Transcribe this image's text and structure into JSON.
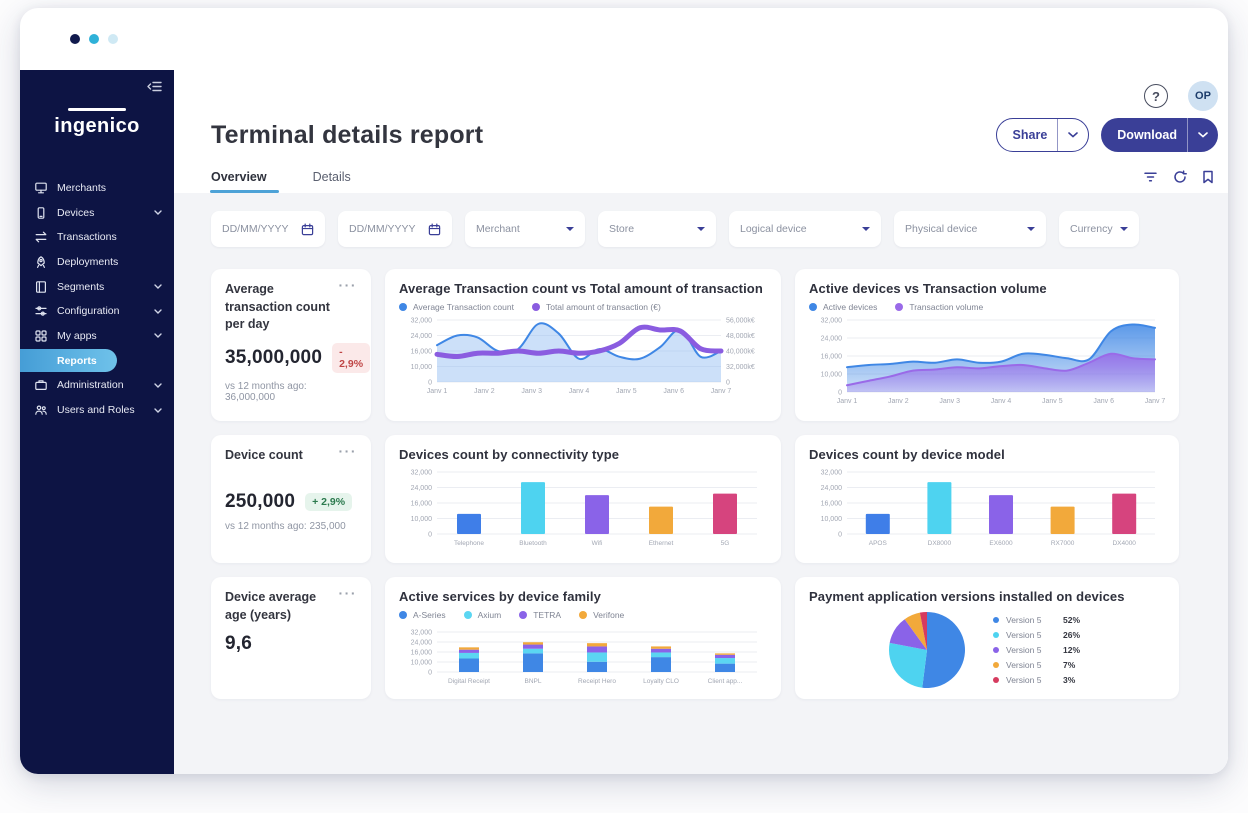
{
  "window": {
    "dots": [
      "#111a4d",
      "#2fb1d8",
      "#cfe9f4"
    ]
  },
  "ui": {
    "menu_icon": "···"
  },
  "sidebar": {
    "logo": "ingenico",
    "items": [
      {
        "label": "Merchants",
        "icon": "merchants"
      },
      {
        "label": "Devices",
        "icon": "devices",
        "chevron": true
      },
      {
        "label": "Transactions",
        "icon": "transactions"
      },
      {
        "label": "Deployments",
        "icon": "deployments"
      },
      {
        "label": "Segments",
        "icon": "segments",
        "chevron": true
      },
      {
        "label": "Configuration",
        "icon": "configuration",
        "chevron": true
      },
      {
        "label": "My apps",
        "icon": "myapps",
        "chevron": true
      },
      {
        "label": "Reports",
        "icon": "none",
        "active": true
      },
      {
        "label": "Administration",
        "icon": "administration",
        "chevron": true
      },
      {
        "label": "Users and Roles",
        "icon": "users",
        "chevron": true
      }
    ]
  },
  "header": {
    "title": "Terminal details report",
    "help_glyph": "?",
    "avatar_initials": "OP",
    "share_label": "Share",
    "download_label": "Download"
  },
  "tabs": [
    {
      "label": "Overview",
      "active": true
    },
    {
      "label": "Details",
      "active": false
    }
  ],
  "toolbar": {
    "icons": [
      "filter-icon",
      "refresh-icon",
      "bookmark-icon"
    ]
  },
  "filters": [
    {
      "name": "date-start",
      "type": "date",
      "placeholder": "DD/MM/YYYY"
    },
    {
      "name": "date-end",
      "type": "date",
      "placeholder": "DD/MM/YYYY"
    },
    {
      "name": "merchant",
      "type": "select",
      "label": "Merchant"
    },
    {
      "name": "store",
      "type": "select",
      "label": "Store"
    },
    {
      "name": "logical-device",
      "type": "select",
      "label": "Logical device"
    },
    {
      "name": "physical-device",
      "type": "select",
      "label": "Physical device"
    },
    {
      "name": "currency",
      "type": "select",
      "label": "Currency"
    }
  ],
  "kpis": [
    {
      "title": "Average transaction count per day",
      "value": "35,000,000",
      "badge": "- 2,9%",
      "badge_type": "negative",
      "note": "vs 12 months ago: 36,000,000"
    },
    {
      "title": "Device count",
      "value": "250,000",
      "badge": "+ 2,9%",
      "badge_type": "positive",
      "note": "vs 12 months ago: 235,000"
    },
    {
      "title": "Device average age (years)",
      "value": "9,6"
    }
  ],
  "chart_data": [
    {
      "type": "line",
      "title": "Average Transaction count vs Total amount of transaction",
      "legend": true,
      "x_labels": [
        "Janv 1",
        "Janv 2",
        "Janv 3",
        "Janv 4",
        "Janv 5",
        "Janv 6",
        "Janv 7"
      ],
      "yticks": [
        "32,000",
        "24,000",
        "16,000",
        "10,000",
        "0"
      ],
      "right_ticks": [
        "56,000k€",
        "48,000k€",
        "40,000k€",
        "32,000k€",
        "0"
      ],
      "ymax": 32000,
      "series": [
        {
          "name": "Average Transaction count",
          "color": "#3f87e5",
          "stroke_width": 2,
          "area_fill": "rgba(143,186,242,0.45)",
          "values": [
            19000,
            24000,
            23000,
            16000,
            17000,
            30000,
            25000,
            12000,
            17000,
            13000,
            12000,
            18000,
            27000,
            13000,
            16000
          ]
        },
        {
          "name": "Total amount of transaction (€)",
          "color": "#8a5ce0",
          "stroke_width": 5,
          "axis_max": 56000,
          "values": [
            25000,
            23000,
            26000,
            26000,
            28000,
            26000,
            28000,
            26000,
            28000,
            35000,
            49000,
            47000,
            46000,
            30000,
            28000
          ]
        }
      ]
    },
    {
      "type": "area",
      "title": "Active devices vs Transaction volume",
      "legend": true,
      "x_labels": [
        "Janv 1",
        "Janv 2",
        "Janv 3",
        "Janv 4",
        "Janv 5",
        "Janv 6",
        "Janv 7"
      ],
      "yticks": [
        "32,000",
        "24,000",
        "16,000",
        "10,000",
        "0"
      ],
      "ymax": 32000,
      "series": [
        {
          "name": "Active devices",
          "color": "#3f87e5",
          "values": [
            11000,
            12000,
            12500,
            13500,
            13000,
            14500,
            13000,
            13500,
            17000,
            16500,
            15000,
            14500,
            27000,
            30000,
            28500
          ]
        },
        {
          "name": "Transaction volume",
          "color": "#9a6ae8",
          "values": [
            3000,
            5000,
            7000,
            9500,
            10000,
            11000,
            10500,
            11500,
            12000,
            10500,
            9500,
            13000,
            17000,
            15000,
            14500
          ]
        }
      ]
    },
    {
      "type": "bar",
      "title": "Devices count by connectivity type",
      "categories": [
        "Telephone",
        "Bluetooth",
        "Wifi",
        "Ethernet",
        "5G"
      ],
      "values": [
        14000,
        36000,
        27000,
        19000,
        28000
      ],
      "colors": [
        "#3f7ee8",
        "#4ed3f0",
        "#8a63e8",
        "#f2a93b",
        "#d6447e"
      ],
      "yticks": [
        "32,000",
        "24,000",
        "16,000",
        "10,000",
        "0"
      ],
      "ymax": 43000
    },
    {
      "type": "bar",
      "title": "Devices count by device model",
      "categories": [
        "APOS",
        "DX8000",
        "EX6000",
        "RX7000",
        "DX4000"
      ],
      "values": [
        14000,
        36000,
        27000,
        19000,
        28000
      ],
      "colors": [
        "#3f7ee8",
        "#4ed3f0",
        "#8a63e8",
        "#f2a93b",
        "#d6447e"
      ],
      "yticks": [
        "32,000",
        "24,000",
        "16,000",
        "10,000",
        "0"
      ],
      "ymax": 43000
    },
    {
      "type": "stacked",
      "title": "Active services by device family",
      "legend": true,
      "categories": [
        "Digital Receipt",
        "BNPL",
        "Receipt Hero",
        "Loyalty CLO",
        "Client app..."
      ],
      "yticks": [
        "32,000",
        "24,000",
        "16,000",
        "10,000",
        "0"
      ],
      "ymax": 43000,
      "series": [
        {
          "name": "A-Series",
          "color": "#3f87e5",
          "values": [
            14500,
            20000,
            11000,
            16000,
            9000
          ]
        },
        {
          "name": "Axium",
          "color": "#5bd6f2",
          "values": [
            6000,
            5000,
            10000,
            5000,
            6000
          ]
        },
        {
          "name": "TETRA",
          "color": "#8a63e8",
          "values": [
            3500,
            4500,
            6500,
            4000,
            3500
          ]
        },
        {
          "name": "Verifone",
          "color": "#f2a93b",
          "values": [
            2500,
            2500,
            3500,
            2500,
            1500
          ]
        }
      ]
    },
    {
      "type": "pie",
      "title": "Payment application versions installed on devices",
      "slices": [
        {
          "label": "Version 5",
          "pct": 52,
          "color": "#3f87e5"
        },
        {
          "label": "Version 5",
          "pct": 26,
          "color": "#4ed3f0"
        },
        {
          "label": "Version 5",
          "pct": 12,
          "color": "#8a63e8"
        },
        {
          "label": "Version 5",
          "pct": 7,
          "color": "#f2a93b"
        },
        {
          "label": "Version 5",
          "pct": 3,
          "color": "#d63b5f"
        }
      ]
    }
  ]
}
